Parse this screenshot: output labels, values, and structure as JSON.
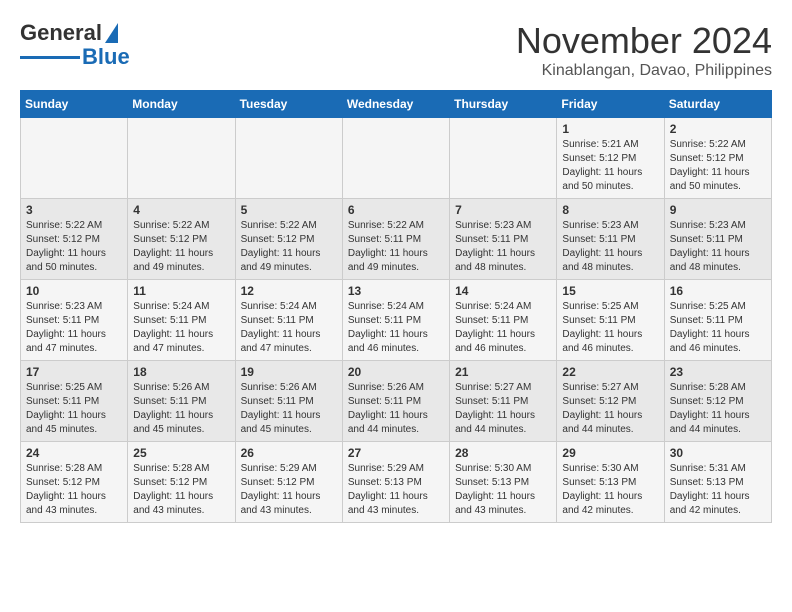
{
  "header": {
    "logo_general": "General",
    "logo_blue": "Blue",
    "title": "November 2024",
    "subtitle": "Kinablangan, Davao, Philippines"
  },
  "calendar": {
    "days_of_week": [
      "Sunday",
      "Monday",
      "Tuesday",
      "Wednesday",
      "Thursday",
      "Friday",
      "Saturday"
    ],
    "weeks": [
      {
        "days": [
          {
            "num": "",
            "info": ""
          },
          {
            "num": "",
            "info": ""
          },
          {
            "num": "",
            "info": ""
          },
          {
            "num": "",
            "info": ""
          },
          {
            "num": "",
            "info": ""
          },
          {
            "num": "1",
            "info": "Sunrise: 5:21 AM\nSunset: 5:12 PM\nDaylight: 11 hours and 50 minutes."
          },
          {
            "num": "2",
            "info": "Sunrise: 5:22 AM\nSunset: 5:12 PM\nDaylight: 11 hours and 50 minutes."
          }
        ]
      },
      {
        "days": [
          {
            "num": "3",
            "info": "Sunrise: 5:22 AM\nSunset: 5:12 PM\nDaylight: 11 hours and 50 minutes."
          },
          {
            "num": "4",
            "info": "Sunrise: 5:22 AM\nSunset: 5:12 PM\nDaylight: 11 hours and 49 minutes."
          },
          {
            "num": "5",
            "info": "Sunrise: 5:22 AM\nSunset: 5:12 PM\nDaylight: 11 hours and 49 minutes."
          },
          {
            "num": "6",
            "info": "Sunrise: 5:22 AM\nSunset: 5:11 PM\nDaylight: 11 hours and 49 minutes."
          },
          {
            "num": "7",
            "info": "Sunrise: 5:23 AM\nSunset: 5:11 PM\nDaylight: 11 hours and 48 minutes."
          },
          {
            "num": "8",
            "info": "Sunrise: 5:23 AM\nSunset: 5:11 PM\nDaylight: 11 hours and 48 minutes."
          },
          {
            "num": "9",
            "info": "Sunrise: 5:23 AM\nSunset: 5:11 PM\nDaylight: 11 hours and 48 minutes."
          }
        ]
      },
      {
        "days": [
          {
            "num": "10",
            "info": "Sunrise: 5:23 AM\nSunset: 5:11 PM\nDaylight: 11 hours and 47 minutes."
          },
          {
            "num": "11",
            "info": "Sunrise: 5:24 AM\nSunset: 5:11 PM\nDaylight: 11 hours and 47 minutes."
          },
          {
            "num": "12",
            "info": "Sunrise: 5:24 AM\nSunset: 5:11 PM\nDaylight: 11 hours and 47 minutes."
          },
          {
            "num": "13",
            "info": "Sunrise: 5:24 AM\nSunset: 5:11 PM\nDaylight: 11 hours and 46 minutes."
          },
          {
            "num": "14",
            "info": "Sunrise: 5:24 AM\nSunset: 5:11 PM\nDaylight: 11 hours and 46 minutes."
          },
          {
            "num": "15",
            "info": "Sunrise: 5:25 AM\nSunset: 5:11 PM\nDaylight: 11 hours and 46 minutes."
          },
          {
            "num": "16",
            "info": "Sunrise: 5:25 AM\nSunset: 5:11 PM\nDaylight: 11 hours and 46 minutes."
          }
        ]
      },
      {
        "days": [
          {
            "num": "17",
            "info": "Sunrise: 5:25 AM\nSunset: 5:11 PM\nDaylight: 11 hours and 45 minutes."
          },
          {
            "num": "18",
            "info": "Sunrise: 5:26 AM\nSunset: 5:11 PM\nDaylight: 11 hours and 45 minutes."
          },
          {
            "num": "19",
            "info": "Sunrise: 5:26 AM\nSunset: 5:11 PM\nDaylight: 11 hours and 45 minutes."
          },
          {
            "num": "20",
            "info": "Sunrise: 5:26 AM\nSunset: 5:11 PM\nDaylight: 11 hours and 44 minutes."
          },
          {
            "num": "21",
            "info": "Sunrise: 5:27 AM\nSunset: 5:11 PM\nDaylight: 11 hours and 44 minutes."
          },
          {
            "num": "22",
            "info": "Sunrise: 5:27 AM\nSunset: 5:12 PM\nDaylight: 11 hours and 44 minutes."
          },
          {
            "num": "23",
            "info": "Sunrise: 5:28 AM\nSunset: 5:12 PM\nDaylight: 11 hours and 44 minutes."
          }
        ]
      },
      {
        "days": [
          {
            "num": "24",
            "info": "Sunrise: 5:28 AM\nSunset: 5:12 PM\nDaylight: 11 hours and 43 minutes."
          },
          {
            "num": "25",
            "info": "Sunrise: 5:28 AM\nSunset: 5:12 PM\nDaylight: 11 hours and 43 minutes."
          },
          {
            "num": "26",
            "info": "Sunrise: 5:29 AM\nSunset: 5:12 PM\nDaylight: 11 hours and 43 minutes."
          },
          {
            "num": "27",
            "info": "Sunrise: 5:29 AM\nSunset: 5:13 PM\nDaylight: 11 hours and 43 minutes."
          },
          {
            "num": "28",
            "info": "Sunrise: 5:30 AM\nSunset: 5:13 PM\nDaylight: 11 hours and 43 minutes."
          },
          {
            "num": "29",
            "info": "Sunrise: 5:30 AM\nSunset: 5:13 PM\nDaylight: 11 hours and 42 minutes."
          },
          {
            "num": "30",
            "info": "Sunrise: 5:31 AM\nSunset: 5:13 PM\nDaylight: 11 hours and 42 minutes."
          }
        ]
      }
    ]
  }
}
